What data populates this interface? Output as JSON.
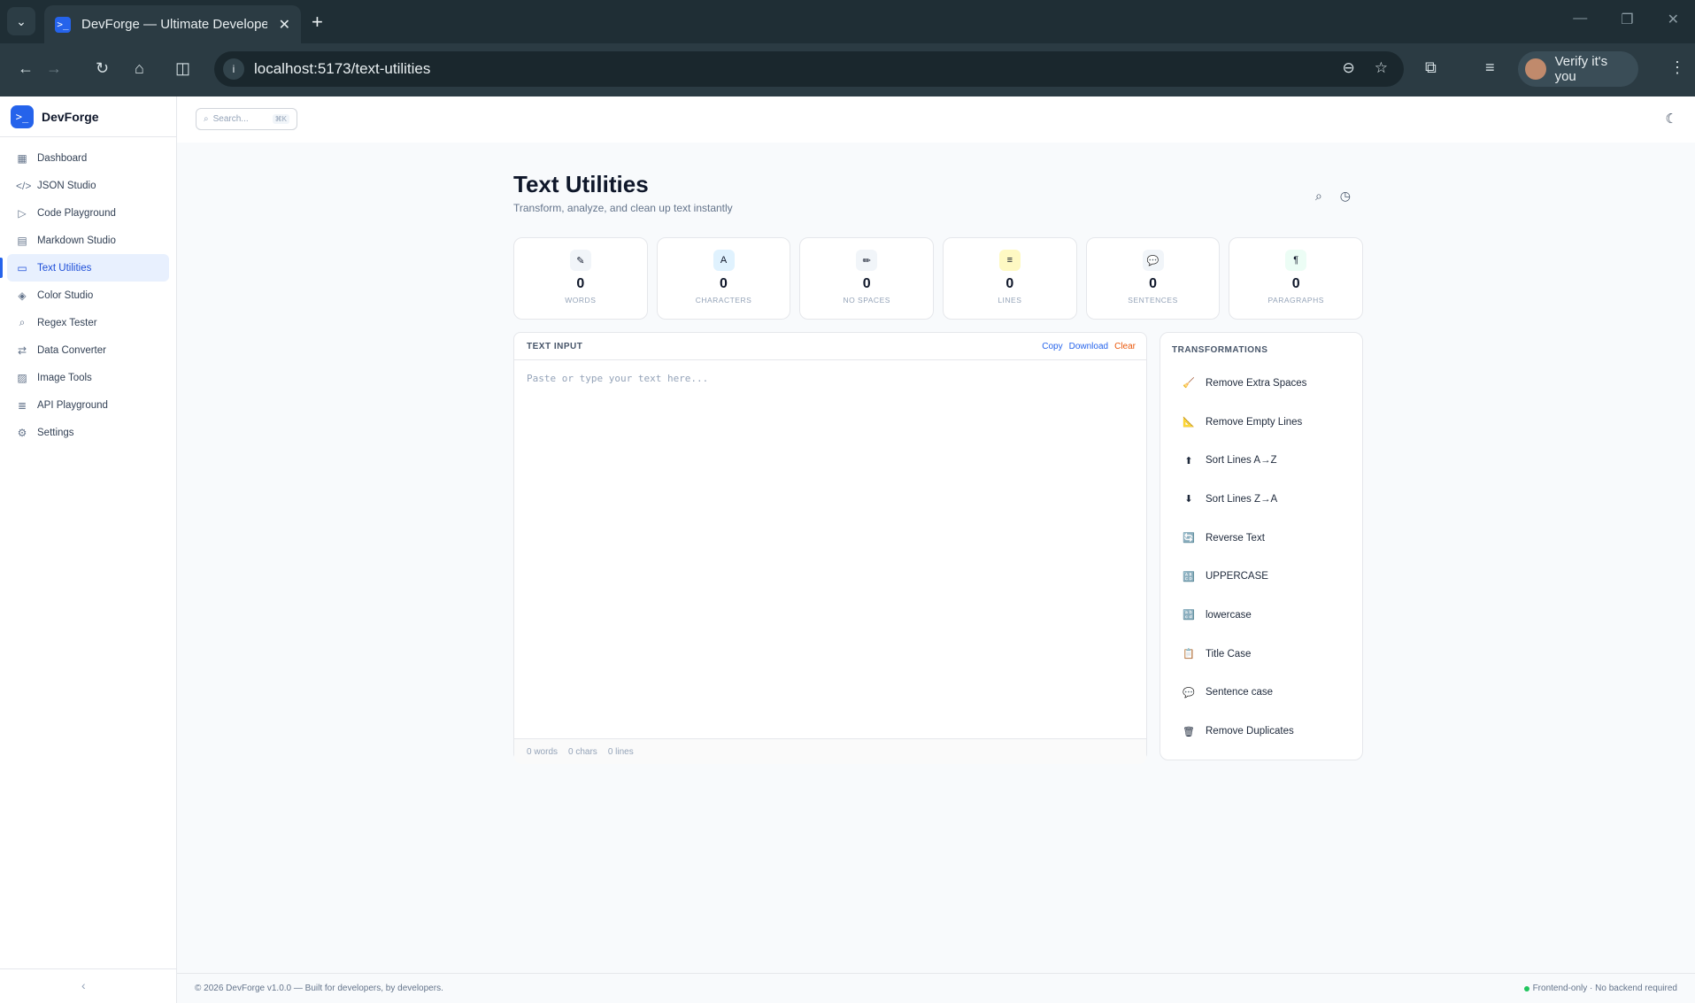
{
  "browser": {
    "tab_title": "DevForge — Ultimate Developer Toolkit",
    "url": "localhost:5173/text-utilities",
    "profile_label": "Verify it's you"
  },
  "app": {
    "brand": "DevForge",
    "search_placeholder": "Search...",
    "search_shortcut": "⌘K"
  },
  "sidebar": {
    "items": [
      {
        "label": "Dashboard",
        "icon": "grid-icon",
        "glyph": "▦"
      },
      {
        "label": "JSON Studio",
        "icon": "code-icon",
        "glyph": "</>"
      },
      {
        "label": "Code Playground",
        "icon": "play-icon",
        "glyph": "▷"
      },
      {
        "label": "Markdown Studio",
        "icon": "file-icon",
        "glyph": "▤"
      },
      {
        "label": "Text Utilities",
        "icon": "message-icon",
        "glyph": "▭",
        "active": true
      },
      {
        "label": "Color Studio",
        "icon": "palette-icon",
        "glyph": "◈"
      },
      {
        "label": "Regex Tester",
        "icon": "search-icon",
        "glyph": "⌕"
      },
      {
        "label": "Data Converter",
        "icon": "swap-icon",
        "glyph": "⇄"
      },
      {
        "label": "Image Tools",
        "icon": "image-icon",
        "glyph": "▨"
      },
      {
        "label": "API Playground",
        "icon": "database-icon",
        "glyph": "≣"
      },
      {
        "label": "Settings",
        "icon": "gear-icon",
        "glyph": "⚙"
      }
    ]
  },
  "page": {
    "title": "Text Utilities",
    "subtitle": "Transform, analyze, and clean up text instantly"
  },
  "stats": [
    {
      "value": "0",
      "label": "WORDS",
      "icon": "pencil-icon",
      "glyph": "✎",
      "color": "#f1f5f9"
    },
    {
      "value": "0",
      "label": "CHARACTERS",
      "icon": "abc-icon",
      "glyph": "A",
      "color": "#e0f2fe"
    },
    {
      "value": "0",
      "label": "NO SPACES",
      "icon": "ruler-icon",
      "glyph": "✏",
      "color": "#f1f5f9"
    },
    {
      "value": "0",
      "label": "LINES",
      "icon": "document-icon",
      "glyph": "≡",
      "color": "#fef9c3"
    },
    {
      "value": "0",
      "label": "SENTENCES",
      "icon": "speech-icon",
      "glyph": "💬",
      "color": "#f1f5f9"
    },
    {
      "value": "0",
      "label": "PARAGRAPHS",
      "icon": "page-icon",
      "glyph": "¶",
      "color": "#ecfdf5"
    }
  ],
  "editor": {
    "title": "TEXT INPUT",
    "copy": "Copy",
    "download": "Download",
    "clear": "Clear",
    "placeholder": "Paste or type your text here...",
    "words": "0 words",
    "chars": "0 chars",
    "lines": "0 lines"
  },
  "transformations": {
    "title": "TRANSFORMATIONS",
    "items": [
      {
        "label": "Remove Extra Spaces",
        "icon": "broom-icon",
        "glyph": "🧹"
      },
      {
        "label": "Remove Empty Lines",
        "icon": "triangle-ruler-icon",
        "glyph": "📐"
      },
      {
        "label": "Sort Lines A→Z",
        "icon": "sort-up-icon",
        "glyph": "⬆"
      },
      {
        "label": "Sort Lines Z→A",
        "icon": "sort-down-icon",
        "glyph": "⬇"
      },
      {
        "label": "Reverse Text",
        "icon": "reverse-icon",
        "glyph": "🔄"
      },
      {
        "label": "UPPERCASE",
        "icon": "uppercase-icon",
        "glyph": "🔠"
      },
      {
        "label": "lowercase",
        "icon": "lowercase-icon",
        "glyph": "🔡"
      },
      {
        "label": "Title Case",
        "icon": "clipboard-icon",
        "glyph": "📋"
      },
      {
        "label": "Sentence case",
        "icon": "speech-icon",
        "glyph": "💬"
      },
      {
        "label": "Remove Duplicates",
        "icon": "trash-icon",
        "glyph": "🗑"
      }
    ]
  },
  "footer": {
    "left": "© 2026 DevForge v1.0.0 — Built for developers, by developers.",
    "right": "Frontend-only · No backend required"
  }
}
